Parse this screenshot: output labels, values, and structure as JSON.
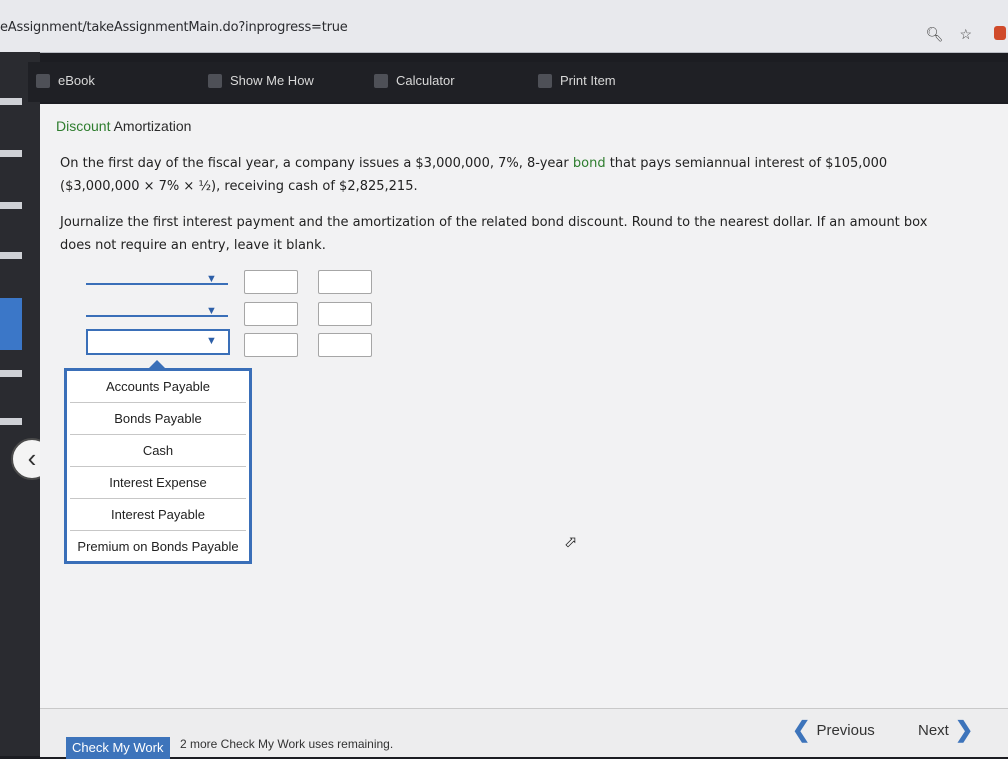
{
  "browser": {
    "url": "eAssignment/takeAssignmentMain.do?inprogress=true"
  },
  "toolbar": {
    "ebook": "eBook",
    "show_me_how": "Show Me How",
    "calculator": "Calculator",
    "print_item": "Print Item"
  },
  "problem": {
    "title_word1": "Discount",
    "title_word2": " Amortization",
    "para1_part1": "On the first day of the fiscal year, a company issues a $3,000,000, 7%, 8-year ",
    "para1_link": "bond",
    "para1_part2": " that pays semiannual interest of $105,000",
    "para1_line2": "($3,000,000 × 7% × ½), receiving cash of $2,825,215.",
    "para2_line1": "Journalize the first interest payment and the amortization of the related bond discount. Round to the nearest dollar. If an amount box",
    "para2_line2": "does not require an entry, leave it blank."
  },
  "dropdown": {
    "options": [
      "Accounts Payable",
      "Bonds Payable",
      "Cash",
      "Interest Expense",
      "Interest Payable",
      "Premium on Bonds Payable"
    ]
  },
  "footer": {
    "check_my_work": "Check My Work",
    "remaining": "2 more Check My Work uses remaining.",
    "previous": "Previous",
    "next": "Next"
  },
  "colors": {
    "accent_blue": "#3d74bb",
    "link_green": "#2e7d2e"
  }
}
